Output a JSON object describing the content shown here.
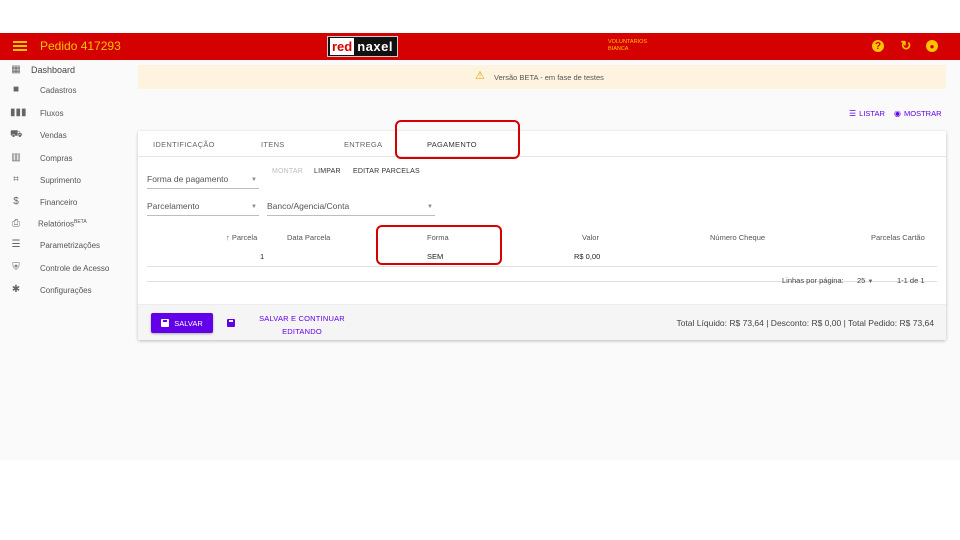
{
  "topbar": {
    "title": "Pedido 417293",
    "logo_red": "red",
    "logo_rest": "naxel",
    "user_line1": "VOLUNTARIOS",
    "user_line2": "BIANCA",
    "help_icon": "help-circle-icon",
    "refresh_icon": "refresh-icon",
    "account_icon": "account-circle-icon",
    "bar_color": "#d50000",
    "accent_color": "#ffc400"
  },
  "sidebar": {
    "items": [
      {
        "label": "Dashboard",
        "icon": "dashboard-icon"
      },
      {
        "label": "Cadastros",
        "icon": "folder-icon"
      },
      {
        "label": "Fluxos",
        "icon": "columns-icon"
      },
      {
        "label": "Vendas",
        "icon": "cart-icon"
      },
      {
        "label": "Compras",
        "icon": "building-icon"
      },
      {
        "label": "Suprimento",
        "icon": "expand-icon"
      },
      {
        "label": "Financeiro",
        "icon": "dollar-icon"
      },
      {
        "label": "Relatórios",
        "sup": "BETA",
        "icon": "printer-icon"
      },
      {
        "label": "Parametrizações",
        "icon": "sliders-icon"
      },
      {
        "label": "Controle de Acesso",
        "icon": "shield-icon"
      },
      {
        "label": "Configurações",
        "icon": "gear-icon"
      }
    ]
  },
  "banner": {
    "text": "Versão BETA - em fase de testes",
    "icon": "warning-icon"
  },
  "view": {
    "listar": "LISTAR",
    "mostrar": "MOSTRAR"
  },
  "tabs": [
    {
      "label": "IDENTIFICAÇÃO"
    },
    {
      "label": "ITENS"
    },
    {
      "label": "ENTREGA"
    },
    {
      "label": "PAGAMENTO",
      "active": true
    }
  ],
  "form": {
    "forma_pagamento": "Forma de pagamento",
    "montar": "MONTAR",
    "limpar": "LIMPAR",
    "editar_parcelas": "EDITAR PARCELAS",
    "parcelamento": "Parcelamento",
    "banco": "Banco/Agencia/Conta"
  },
  "table": {
    "headers": {
      "parcela": "Parcela",
      "data_parcela": "Data Parcela",
      "forma": "Forma",
      "valor": "Valor",
      "numero_cheque": "Número Cheque",
      "parcelas_cartao": "Parcelas Cartão"
    },
    "rows": [
      {
        "parcela": "1",
        "data_parcela": "",
        "forma": "SEM",
        "valor": "R$ 0,00",
        "numero_cheque": "",
        "parcelas_cartao": ""
      }
    ]
  },
  "pagination": {
    "rows_label": "Linhas por página:",
    "rows_value": "25",
    "range": "1-1 de 1"
  },
  "footer": {
    "save": "SALVAR",
    "save_continue_1": "SALVAR E CONTINUAR",
    "save_continue_2": "EDITANDO",
    "totals": "Total Líquido: R$ 73,64 | Desconto: R$ 0,00 | Total Pedido: R$ 73,64"
  },
  "brand_color": "#6200ea",
  "highlight_color": "#d50000"
}
